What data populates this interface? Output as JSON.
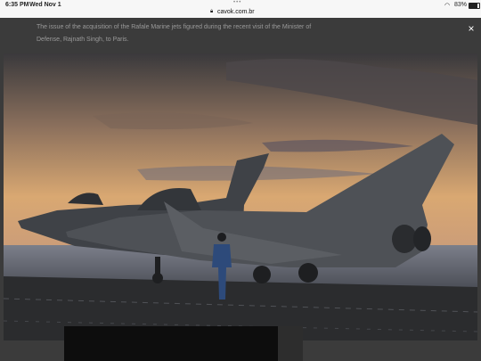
{
  "status_bar": {
    "time": "6:35 PM",
    "date": "Wed Nov 1",
    "url": "cavok.com.br",
    "battery": "83%",
    "battery_level": 0.83,
    "wifi_icon": "wifi-icon",
    "lock_icon": "lock-icon"
  },
  "article": {
    "caption": "The issue of the acquisition of the Rafale Marine jets figured during the recent visit of the Minister of Defense, Rajnath Singh, to Paris.",
    "close_label": "×"
  },
  "colors": {
    "page_bg": "#3b3b3b",
    "sky_top": "#3d3a3c",
    "sky_glow": "#e6b27a",
    "deck": "#2b2c2e",
    "jet": "#4e5156"
  }
}
